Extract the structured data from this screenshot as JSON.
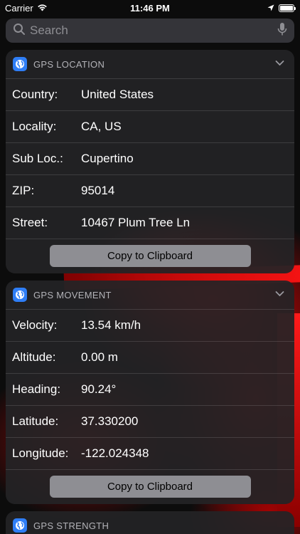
{
  "status_bar": {
    "carrier": "Carrier",
    "time": "11:46 PM",
    "battery_level": 1.0
  },
  "search": {
    "placeholder": "Search"
  },
  "widgets": [
    {
      "title": "GPS LOCATION",
      "rows": [
        {
          "label": "Country:",
          "value": "United States"
        },
        {
          "label": "Locality:",
          "value": "CA, US"
        },
        {
          "label": "Sub Loc.:",
          "value": "Cupertino"
        },
        {
          "label": "ZIP:",
          "value": "95014"
        },
        {
          "label": "Street:",
          "value": "10467 Plum Tree Ln"
        }
      ],
      "button": "Copy to Clipboard"
    },
    {
      "title": "GPS MOVEMENT",
      "rows": [
        {
          "label": "Velocity:",
          "value": "13.54 km/h"
        },
        {
          "label": "Altitude:",
          "value": "0.00 m"
        },
        {
          "label": "Heading:",
          "value": "90.24°"
        },
        {
          "label": "Latitude:",
          "value": "37.330200"
        },
        {
          "label": "Longitude:",
          "value": "-122.024348"
        }
      ],
      "button": "Copy to Clipboard"
    },
    {
      "title": "GPS STRENGTH"
    }
  ],
  "icons": {
    "signal": "wifi-icon",
    "location": "location-arrow-icon",
    "battery": "battery-icon",
    "search": "search-icon",
    "mic": "microphone-icon",
    "app": "globe-icon",
    "expand": "chevron-down-icon"
  },
  "colors": {
    "accent": "#2f7ef6",
    "wallpaper_red": "#ff0000"
  }
}
